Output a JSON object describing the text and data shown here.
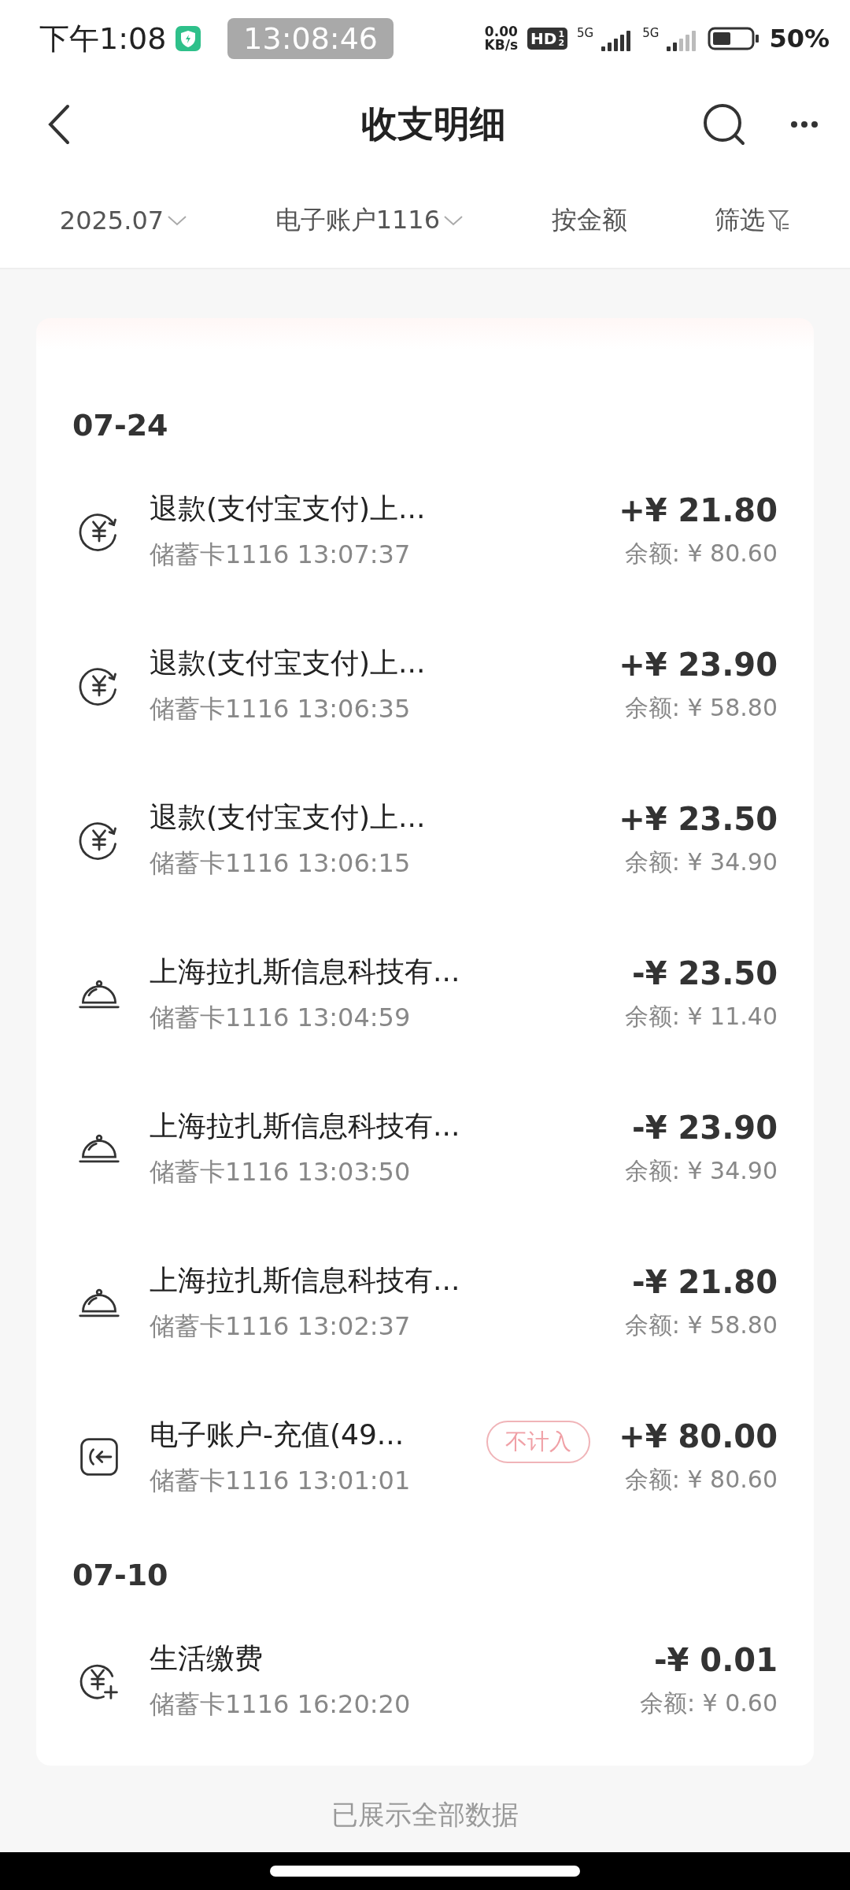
{
  "status_bar": {
    "time": "下午1:08",
    "recorder_timer": "13:08:46",
    "net_speed": "0.00",
    "net_unit": "KB/s",
    "hd_badge": {
      "text": "HD",
      "sup": "1",
      "sub": "2"
    },
    "sim_labels": [
      "5G",
      "5G"
    ],
    "battery": "50%"
  },
  "header": {
    "title": "收支明细"
  },
  "filters": [
    {
      "label": "2025.07",
      "kind": "dropdown"
    },
    {
      "label": "电子账户1116",
      "kind": "dropdown"
    },
    {
      "label": "按金额",
      "kind": "plain"
    },
    {
      "label": "筛选",
      "kind": "filter"
    }
  ],
  "groups": [
    {
      "date": "07-24",
      "items": [
        {
          "kind": "refund",
          "title": "退款(支付宝支付)上...",
          "subtitle": "储蓄卡1116 13:07:37",
          "amount": "+¥ 21.80",
          "balance": "余额: ¥ 80.60"
        },
        {
          "kind": "refund",
          "title": "退款(支付宝支付)上...",
          "subtitle": "储蓄卡1116 13:06:35",
          "amount": "+¥ 23.90",
          "balance": "余额: ¥ 58.80"
        },
        {
          "kind": "refund",
          "title": "退款(支付宝支付)上...",
          "subtitle": "储蓄卡1116 13:06:15",
          "amount": "+¥ 23.50",
          "balance": "余额: ¥ 34.90"
        },
        {
          "kind": "meal",
          "title": "上海拉扎斯信息科技有...",
          "subtitle": "储蓄卡1116 13:04:59",
          "amount": "-¥ 23.50",
          "balance": "余额: ¥ 11.40"
        },
        {
          "kind": "meal",
          "title": "上海拉扎斯信息科技有...",
          "subtitle": "储蓄卡1116 13:03:50",
          "amount": "-¥ 23.90",
          "balance": "余额: ¥ 34.90"
        },
        {
          "kind": "meal",
          "title": "上海拉扎斯信息科技有...",
          "subtitle": "储蓄卡1116 13:02:37",
          "amount": "-¥ 21.80",
          "balance": "余额: ¥ 58.80"
        },
        {
          "kind": "transfer",
          "title": "电子账户-充值(49...",
          "subtitle": "储蓄卡1116 13:01:01",
          "tag": "不计入",
          "amount": "+¥ 80.00",
          "balance": "余额: ¥ 80.60"
        }
      ]
    },
    {
      "date": "07-10",
      "items": [
        {
          "kind": "utility",
          "title": "生活缴费",
          "subtitle": "储蓄卡1116 16:20:20",
          "amount": "-¥ 0.01",
          "balance": "余额: ¥ 0.60"
        }
      ]
    }
  ],
  "footer": {
    "text": "已展示全部数据"
  }
}
